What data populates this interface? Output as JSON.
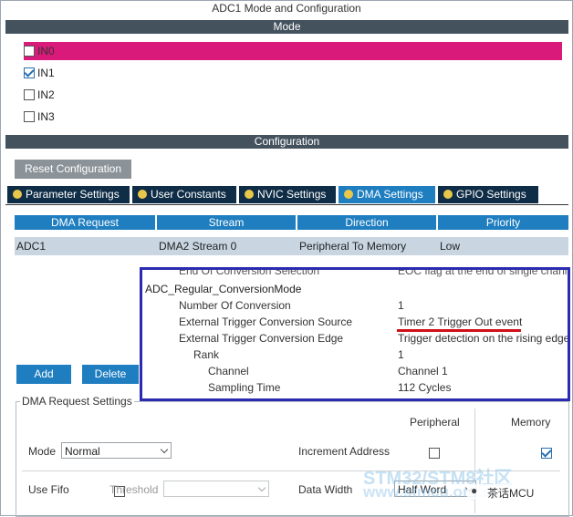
{
  "window": {
    "title": "ADC1 Mode and Configuration"
  },
  "mode": {
    "header": "Mode",
    "channels": [
      {
        "label": "IN0",
        "checked": false,
        "selected": true
      },
      {
        "label": "IN1",
        "checked": true,
        "selected": false
      },
      {
        "label": "IN2",
        "checked": false,
        "selected": false
      },
      {
        "label": "IN3",
        "checked": false,
        "selected": false
      }
    ]
  },
  "configuration": {
    "header": "Configuration",
    "reset_label": "Reset Configuration",
    "tabs": [
      {
        "label": "Parameter Settings",
        "active": false
      },
      {
        "label": "User Constants",
        "active": false
      },
      {
        "label": "NVIC Settings",
        "active": false
      },
      {
        "label": "DMA Settings",
        "active": true
      },
      {
        "label": "GPIO Settings",
        "active": false
      }
    ]
  },
  "dma_table": {
    "columns": [
      "DMA Request",
      "Stream",
      "Direction",
      "Priority"
    ],
    "rows": [
      [
        "ADC1",
        "DMA2 Stream 0",
        "Peripheral To Memory",
        "Low"
      ]
    ]
  },
  "buttons": {
    "add": "Add",
    "delete": "Delete"
  },
  "overlay": {
    "cut_row": {
      "name": "End Of Conversion Selection",
      "value": "EOC flag at the end of single chann"
    },
    "section": "ADC_Regular_ConversionMode",
    "params": [
      {
        "name": "Number Of Conversion",
        "value": "1"
      },
      {
        "name": "External Trigger Conversion Source",
        "value": "Timer 2 Trigger Out event"
      },
      {
        "name": "External Trigger Conversion Edge",
        "value": "Trigger detection on the rising edge"
      },
      {
        "name": "Rank",
        "value": "1"
      },
      {
        "name": "Channel",
        "value": "Channel 1"
      },
      {
        "name": "Sampling Time",
        "value": "112 Cycles"
      }
    ]
  },
  "dma_request_settings": {
    "legend": "DMA Request Settings",
    "peripheral_header": "Peripheral",
    "memory_header": "Memory",
    "mode_label": "Mode",
    "mode_value": "Normal",
    "increment_label": "Increment Address",
    "use_fifo_label": "Use Fifo",
    "threshold_label": "Threshold",
    "threshold_value": "",
    "data_width_label": "Data Width",
    "data_width_value": "Half Word",
    "peripheral_increment": false,
    "memory_increment": true,
    "use_fifo": false
  },
  "watermark": {
    "line1": "STM32/STM8社区",
    "line2": "www.stmcu.org.cn",
    "badge": "茶话MCU"
  },
  "colors": {
    "selected_row": "#d91a7a",
    "header_bar": "#44525e",
    "accent": "#1f7ec0",
    "highlight_box": "#2a2bb0",
    "underline": "#d0101a"
  }
}
